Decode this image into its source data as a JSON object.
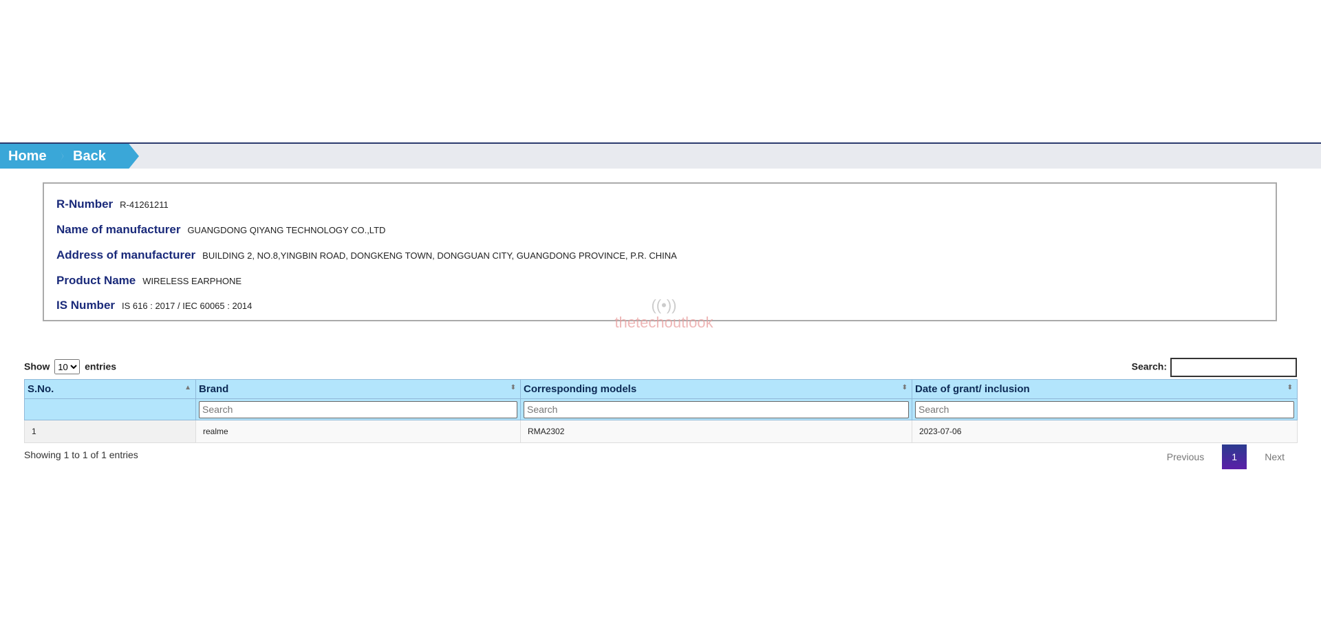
{
  "breadcrumb": {
    "home": "Home",
    "back": "Back"
  },
  "details": [
    {
      "label": "R-Number",
      "value": "R-41261211"
    },
    {
      "label": "Name of manufacturer",
      "value": "GUANGDONG QIYANG TECHNOLOGY CO.,LTD"
    },
    {
      "label": "Address of manufacturer",
      "value": "BUILDING 2, NO.8,YINGBIN ROAD, DONGKENG TOWN, DONGGUAN CITY, GUANGDONG PROVINCE, P.R. CHINA"
    },
    {
      "label": "Product Name",
      "value": "WIRELESS EARPHONE"
    },
    {
      "label": "IS Number",
      "value": "IS 616 : 2017 / IEC 60065 : 2014"
    }
  ],
  "watermark": {
    "text": "thetechoutlook",
    "icon": "antenna-icon"
  },
  "table_controls": {
    "show_label": "Show",
    "entries_label": "entries",
    "page_length": "10",
    "search_label": "Search:"
  },
  "table": {
    "columns": [
      "S.No.",
      "Brand",
      "Corresponding models",
      "Date of grant/ inclusion"
    ],
    "filter_placeholder": "Search",
    "rows": [
      [
        "1",
        "realme",
        "RMA2302",
        "2023-07-06"
      ]
    ]
  },
  "footer": {
    "info": "Showing 1 to 1 of 1 entries",
    "previous": "Previous",
    "current_page": "1",
    "next": "Next"
  },
  "colors": {
    "breadcrumb": "#3aa7d8",
    "header": "#b3e5fc",
    "label": "#1a2a7a",
    "page_active": "#2b3b8f"
  }
}
